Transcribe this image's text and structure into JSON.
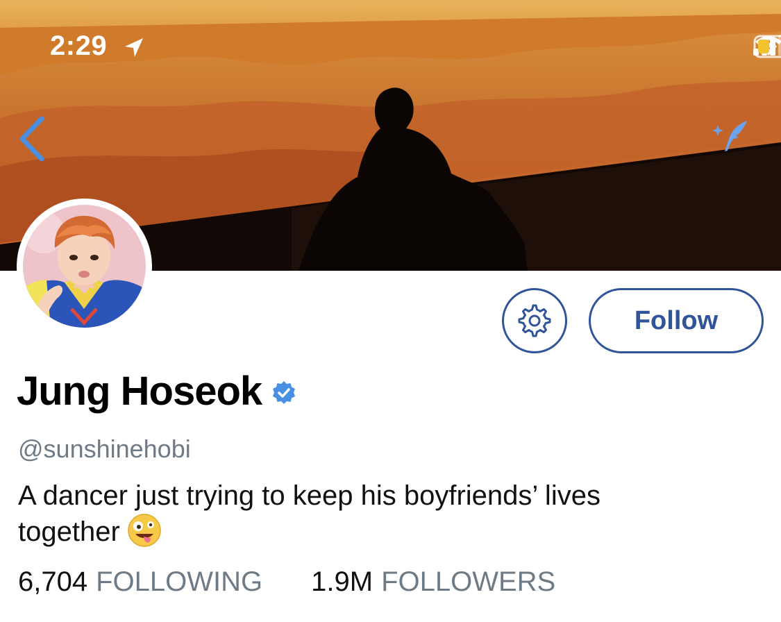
{
  "status_bar": {
    "time": "2:29"
  },
  "header": {
    "banner_description_icon": "banner-image",
    "back_icon": "chevron-left-icon",
    "compose_icon": "quill-sparkle-icon"
  },
  "profile": {
    "display_name": "Jung Hoseok",
    "verified": true,
    "handle": "@sunshinehobi",
    "bio_line1": "A dancer just trying to keep his boyfriends’ lives",
    "bio_line2": "together",
    "bio_emoji": "zany-face-emoji"
  },
  "actions": {
    "settings_icon": "gear-icon",
    "follow_label": "Follow"
  },
  "stats": {
    "following_count": "6,704",
    "following_label": "FOLLOWING",
    "followers_count": "1.9M",
    "followers_label": "FOLLOWERS"
  },
  "colors": {
    "accent": "#2f5499",
    "verified": "#4a90e2",
    "muted_text": "#6e7a86",
    "back_arrow": "#4a90e2"
  }
}
